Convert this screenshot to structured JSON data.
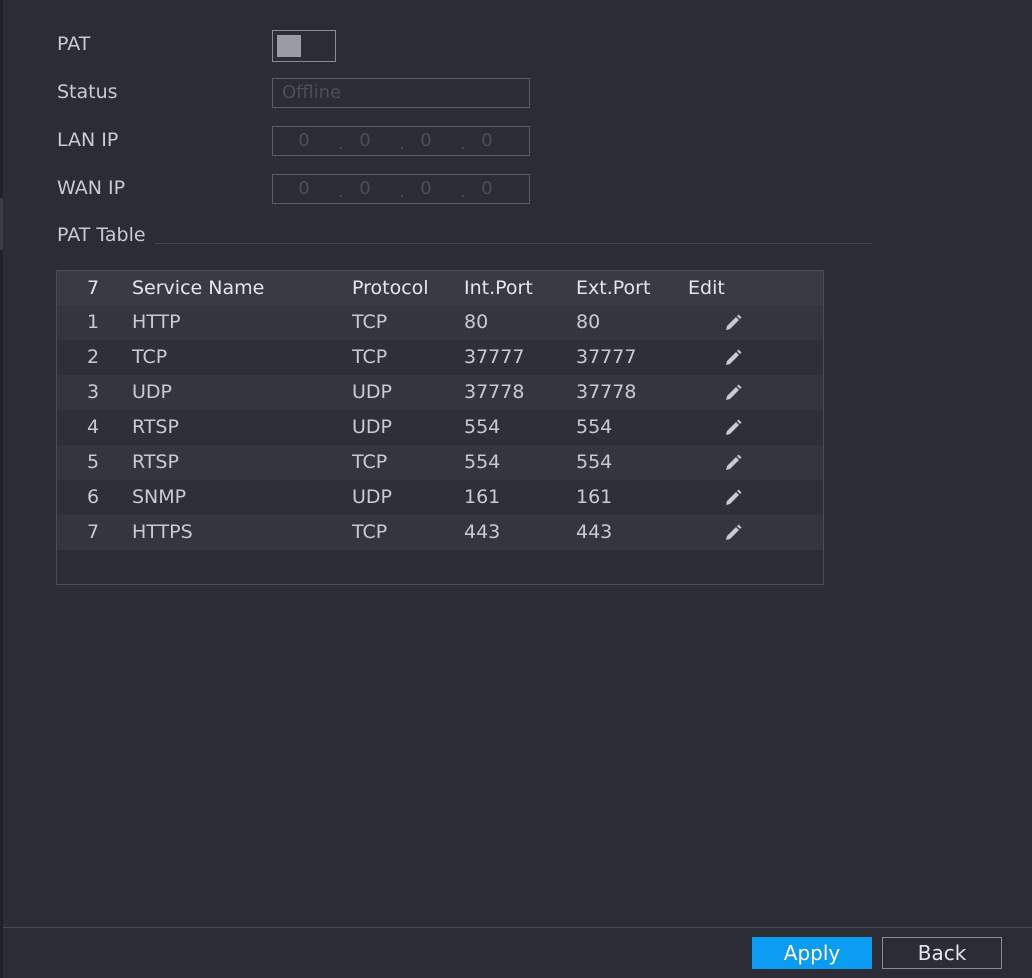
{
  "colors": {
    "background": "#2b2c35",
    "accent": "#0a9cf0",
    "text": "#c9cbd2",
    "placeholder": "#4d4f58"
  },
  "form": {
    "pat": {
      "label": "PAT",
      "enabled": false
    },
    "status": {
      "label": "Status",
      "value": "Offline"
    },
    "lan_ip": {
      "label": "LAN IP",
      "octets": [
        "0",
        "0",
        "0",
        "0"
      ]
    },
    "wan_ip": {
      "label": "WAN IP",
      "octets": [
        "0",
        "0",
        "0",
        "0"
      ]
    }
  },
  "pat_table": {
    "title": "PAT Table",
    "headers": {
      "count": "7",
      "service_name": "Service Name",
      "protocol": "Protocol",
      "int_port": "Int.Port",
      "ext_port": "Ext.Port",
      "edit": "Edit"
    },
    "rows": [
      {
        "no": "1",
        "service": "HTTP",
        "protocol": "TCP",
        "int_port": "80",
        "ext_port": "80",
        "edit_icon": "pencil-icon"
      },
      {
        "no": "2",
        "service": "TCP",
        "protocol": "TCP",
        "int_port": "37777",
        "ext_port": "37777",
        "edit_icon": "pencil-icon"
      },
      {
        "no": "3",
        "service": "UDP",
        "protocol": "UDP",
        "int_port": "37778",
        "ext_port": "37778",
        "edit_icon": "pencil-icon"
      },
      {
        "no": "4",
        "service": "RTSP",
        "protocol": "UDP",
        "int_port": "554",
        "ext_port": "554",
        "edit_icon": "pencil-icon"
      },
      {
        "no": "5",
        "service": "RTSP",
        "protocol": "TCP",
        "int_port": "554",
        "ext_port": "554",
        "edit_icon": "pencil-icon"
      },
      {
        "no": "6",
        "service": "SNMP",
        "protocol": "UDP",
        "int_port": "161",
        "ext_port": "161",
        "edit_icon": "pencil-icon"
      },
      {
        "no": "7",
        "service": "HTTPS",
        "protocol": "TCP",
        "int_port": "443",
        "ext_port": "443",
        "edit_icon": "pencil-icon"
      }
    ]
  },
  "footer": {
    "apply_label": "Apply",
    "back_label": "Back"
  }
}
